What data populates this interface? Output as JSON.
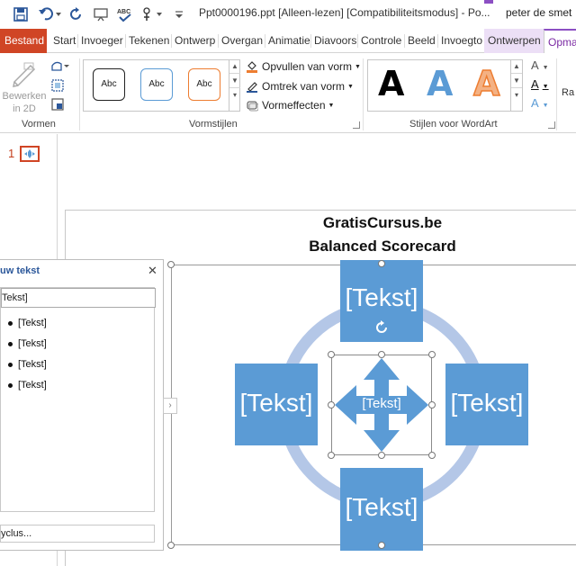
{
  "window": {
    "title": "Ppt0000196.ppt [Alleen-lezen] [Compatibiliteitsmodus] - Po...",
    "user": "peter de smet"
  },
  "quick_access": {
    "save_icon": "save-icon",
    "undo_icon": "undo-icon",
    "redo_icon": "redo-icon",
    "present_icon": "present-icon",
    "spelling_icon": "spelling-icon",
    "touch_icon": "touch-icon"
  },
  "tabs": [
    {
      "label": "Bestand"
    },
    {
      "label": "Start"
    },
    {
      "label": "Invoeger"
    },
    {
      "label": "Tekenen"
    },
    {
      "label": "Ontwerp"
    },
    {
      "label": "Overgan"
    },
    {
      "label": "Animatie"
    },
    {
      "label": "Diavoors"
    },
    {
      "label": "Controle"
    },
    {
      "label": "Beeld"
    },
    {
      "label": "Invoegto"
    },
    {
      "label": "Ontwerpen"
    },
    {
      "label": "Opma"
    }
  ],
  "ribbon": {
    "vormen": {
      "edit_2d_line1": "Bewerken",
      "edit_2d_line2": "in 2D",
      "label": "Vormen"
    },
    "vormstijlen": {
      "swatch_label": "Abc",
      "fill": "Opvullen van vorm",
      "outline": "Omtrek van vorm",
      "effects": "Vormeffecten",
      "label": "Vormstijlen"
    },
    "wordart": {
      "sample": "A",
      "label": "Stijlen voor WordArt",
      "text_fill_icon": "A",
      "text_outline_icon": "A",
      "text_effects_icon": "A"
    },
    "right_cut": "Ra",
    "colors": {
      "accent_orange": "#ed7d31",
      "accent_blue": "#5b9bd5",
      "file_tab": "#d04525",
      "context_purple": "#8c4fc3"
    }
  },
  "slides_pane": {
    "slide_number": "1"
  },
  "slide": {
    "title_line1": "GratisCursus.be",
    "title_line2": "Balanced Scorecard",
    "top_box": "[Tekst]",
    "left_box": "[Tekst]",
    "right_box": "[Tekst]",
    "bottom_box": "[Tekst]",
    "center_arrow": "[Tekst]"
  },
  "text_pane": {
    "title": "uw tekst",
    "first_line": "Tekst]",
    "bullets": [
      "[Tekst]",
      "[Tekst]",
      "[Tekst]",
      "[Tekst]"
    ],
    "footer": "yclus..."
  }
}
